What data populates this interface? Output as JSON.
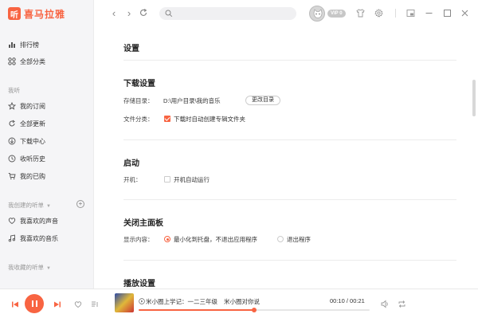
{
  "app": {
    "logo_glyph": "听",
    "logo_text": "喜马拉雅"
  },
  "sidebar": {
    "top_items": [
      {
        "label": "排行榜",
        "icon": "chart-icon"
      },
      {
        "label": "全部分类",
        "icon": "grid-icon"
      }
    ],
    "my_listen_header": "我听",
    "my_items": [
      {
        "label": "我的订阅",
        "icon": "star-icon"
      },
      {
        "label": "全部更新",
        "icon": "refresh-icon"
      },
      {
        "label": "下载中心",
        "icon": "download-icon"
      },
      {
        "label": "收听历史",
        "icon": "clock-icon"
      },
      {
        "label": "我的已购",
        "icon": "cart-icon"
      }
    ],
    "created_header": "我创建的听单",
    "created_items": [
      {
        "label": "我喜欢的声音",
        "icon": "heart-icon"
      },
      {
        "label": "我喜欢的音乐",
        "icon": "music-icon"
      }
    ],
    "collected_header": "我收藏的听单"
  },
  "toolbar": {
    "back": "‹",
    "forward": "›",
    "search_placeholder": "",
    "vip": "VIP 0"
  },
  "settings": {
    "page_title": "设置",
    "download": {
      "title": "下载设置",
      "dir_label": "存储目录：",
      "dir_value": "D:\\用户目录\\我的音乐",
      "change_button": "更改目录",
      "classify_label": "文件分类：",
      "classify_option": "下载时自动创建专辑文件夹",
      "classify_checked": true
    },
    "startup": {
      "title": "启动",
      "label": "开机：",
      "option": "开机自动运行",
      "checked": false
    },
    "close_panel": {
      "title": "关闭主面板",
      "label": "显示内容：",
      "options": [
        {
          "label": "最小化到托盘，不退出应用程序",
          "selected": true
        },
        {
          "label": "退出程序",
          "selected": false
        }
      ]
    },
    "playback": {
      "title": "播放设置"
    }
  },
  "player": {
    "title": "米小圈上学记：一二三年级",
    "artist": "米小圈对你说",
    "elapsed": "00:10",
    "total": "00:21",
    "progress": 0.5
  },
  "colors": {
    "accent": "#f86442"
  }
}
